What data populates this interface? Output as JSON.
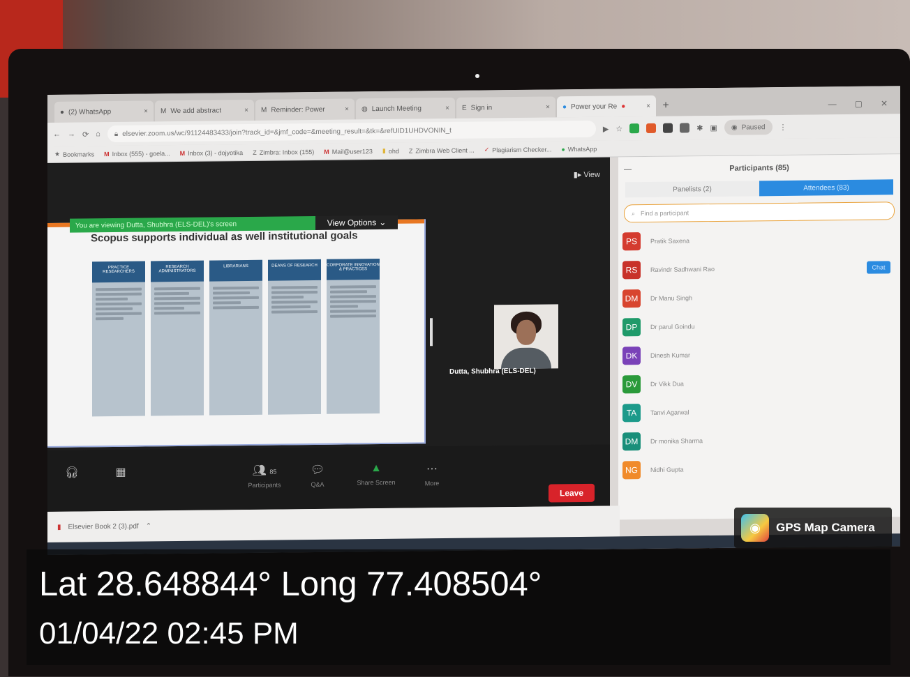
{
  "browser": {
    "tabs": [
      {
        "label": "(2) WhatsApp",
        "active": false
      },
      {
        "label": "We add abstract",
        "active": false
      },
      {
        "label": "Reminder: Power",
        "active": false
      },
      {
        "label": "Launch Meeting",
        "active": false
      },
      {
        "label": "Sign in",
        "active": false
      },
      {
        "label": "Power your Re",
        "active": true
      }
    ],
    "url": "elsevier.zoom.us/wc/91124483433/join?track_id=&jmf_code=&meeting_result=&tk=&refUID1UHDVONIN_t",
    "profile_label": "Paused",
    "bookmarks": [
      "Bookmarks",
      "Inbox (555) - goela...",
      "Inbox (3) - dojyotika",
      "Zimbra: Inbox (155)",
      "Mail@user123",
      "ohd",
      "Zimbra Web Client ...",
      "Plagiarism Checker...",
      "WhatsApp"
    ]
  },
  "zoom": {
    "view_label": "View",
    "share_banner": "You are viewing Dutta, Shubhra (ELS-DEL)'s screen",
    "view_options_label": "View Options",
    "slide_title": "Scopus supports individual as well institutional goals",
    "slide_columns": [
      "PRACTICE RESEARCHERS",
      "RESEARCH ADMINISTRATORS",
      "LIBRARIANS",
      "DEANS OF RESEARCH",
      "CORPORATE INNOVATION & PRACTICES"
    ],
    "video_name": "Dutta, Shubhra (ELS-DEL)",
    "toolbar": {
      "participants": {
        "label": "Participants",
        "count": "85"
      },
      "qa": "Q&A",
      "share_screen": "Share Screen",
      "more": "More",
      "leave": "Leave"
    }
  },
  "participants": {
    "title": "Participants (85)",
    "tabs": {
      "panelists": "Panelists (2)",
      "attendees": "Attendees (83)"
    },
    "search_placeholder": "Find a participant",
    "chat_label": "Chat",
    "list": [
      {
        "initials": "PS",
        "name": "Pratik Saxena",
        "color": "#d43b2f"
      },
      {
        "initials": "RS",
        "name": "Ravindr Sadhwani Rao",
        "color": "#c8322a"
      },
      {
        "initials": "DM",
        "name": "Dr Manu Singh",
        "color": "#d8452f"
      },
      {
        "initials": "DP",
        "name": "Dr parul Goindu",
        "color": "#1f9a6a"
      },
      {
        "initials": "DK",
        "name": "Dinesh Kumar",
        "color": "#7a42b8"
      },
      {
        "initials": "DV",
        "name": "Dr Vikk Dua",
        "color": "#2a9a3a"
      },
      {
        "initials": "TA",
        "name": "Tanvi Agarwal",
        "color": "#1c9a8a"
      },
      {
        "initials": "DM",
        "name": "Dr monika Sharma",
        "color": "#1a8f7a"
      },
      {
        "initials": "NG",
        "name": "Nidhi Gupta",
        "color": "#f08a2a"
      }
    ]
  },
  "download_bar": {
    "filename": "Elsevier Book 2 (3).pdf"
  },
  "overlay": {
    "app_name": "GPS Map Camera",
    "lat_long": "Lat 28.648844° Long 77.408504°",
    "datetime": "01/04/22 02:45 PM"
  }
}
